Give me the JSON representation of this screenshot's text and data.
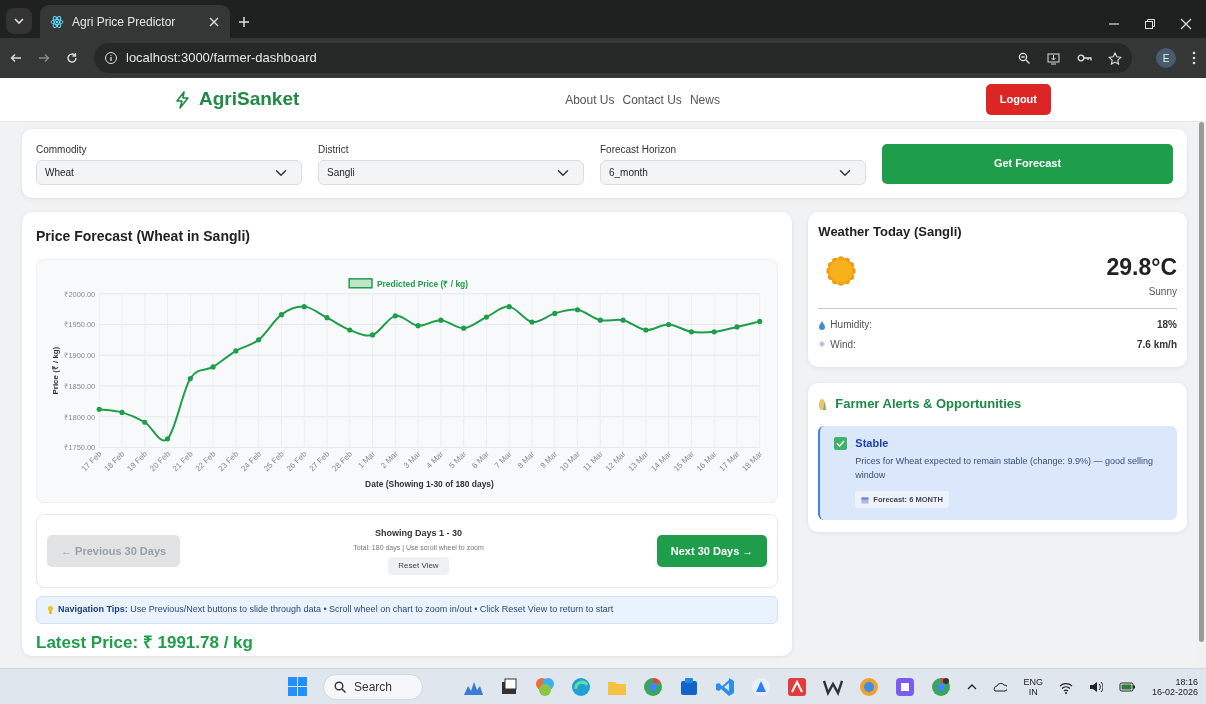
{
  "browser": {
    "tab_title": "Agri Price Predictor",
    "url": "localhost:3000/farmer-dashboard",
    "profile": "E"
  },
  "navbar": {
    "brand": "AgriSanket",
    "links": [
      "About Us",
      "Contact Us",
      "News"
    ],
    "logout": "Logout"
  },
  "filters": [
    {
      "label": "Commodity",
      "value": "Wheat"
    },
    {
      "label": "District",
      "value": "Sangli"
    },
    {
      "label": "Forecast Horizon",
      "value": "6_month"
    }
  ],
  "forecast_button": "Get Forecast",
  "forecast_panel": {
    "title": "Price Forecast (Wheat in Sangli)",
    "chart_data": {
      "type": "line",
      "grid": true,
      "xlabel": "Date (Showing 1-30 of 180 days)",
      "ylabel": "Price (₹ / kg)",
      "categories": [
        "17 Feb",
        "18 Feb",
        "19 Feb",
        "20 Feb",
        "21 Feb",
        "22 Feb",
        "23 Feb",
        "24 Feb",
        "25 Feb",
        "26 Feb",
        "27 Feb",
        "28 Feb",
        "1 Mar",
        "2 Mar",
        "3 Mar",
        "4 Mar",
        "5 Mar",
        "6 Mar",
        "7 Mar",
        "8 Mar",
        "9 Mar",
        "10 Mar",
        "11 Mar",
        "12 Mar",
        "13 Mar",
        "14 Mar",
        "15 Mar",
        "16 Mar",
        "17 Mar",
        "18 Mar"
      ],
      "series": [
        {
          "name": "Predicted Price (₹ / kg)",
          "color": "#1e9e4a",
          "values": [
            1812,
            1807,
            1791,
            1764,
            1862,
            1881,
            1907,
            1925,
            1966,
            1979,
            1961,
            1941,
            1933,
            1964,
            1948,
            1957,
            1944,
            1962,
            1979,
            1954,
            1968,
            1974,
            1957,
            1957,
            1941,
            1950,
            1938,
            1938,
            1946,
            1955
          ]
        }
      ],
      "ylim": [
        1750,
        2000
      ],
      "yticks": [
        {
          "value": 1750,
          "label": "₹1750.00"
        },
        {
          "value": 1800,
          "label": "₹1800.00"
        },
        {
          "value": 1850,
          "label": "₹1850.00"
        },
        {
          "value": 1900,
          "label": "₹1900.00"
        },
        {
          "value": 1950,
          "label": "₹1950.00"
        },
        {
          "value": 2000,
          "label": "₹2000.00"
        }
      ]
    },
    "pager": {
      "previous": {
        "label": "← Previous 30 Days",
        "disabled": true
      },
      "status": "Showing Days 1 - 30",
      "detail": "Total: 180 days | Use scroll wheel to zoom",
      "reset": "Reset View",
      "next": {
        "label": "Next 30 Days →",
        "disabled": false
      }
    },
    "tip": "**Navigation Tips:** Use Previous/Next buttons to slide through data • Scroll wheel on chart to zoom in/out • Click Reset View to return to start",
    "latest_price": "Latest Price: ₹ 1991.78 / kg"
  },
  "weather": {
    "title": "Weather Today (Sangli)",
    "temperature": "29.8°C",
    "condition": "Sunny",
    "rows": [
      {
        "kind": "humidity",
        "label": "Humidity:",
        "value": "18%"
      },
      {
        "kind": "wind",
        "label": "Wind:",
        "value": "7.6 km/h"
      }
    ]
  },
  "alerts": {
    "title": "Farmer Alerts & Opportunities",
    "items": [
      {
        "title": "Stable",
        "message": "Prices for Wheat expected to remain stable (change: 9.9%) — good selling window",
        "badge": "Forecast: 6 MONTH"
      }
    ]
  },
  "taskbar": {
    "search": "Search",
    "language": "ENG",
    "region": "IN",
    "time": "18:16",
    "date": "16-02-2026"
  }
}
